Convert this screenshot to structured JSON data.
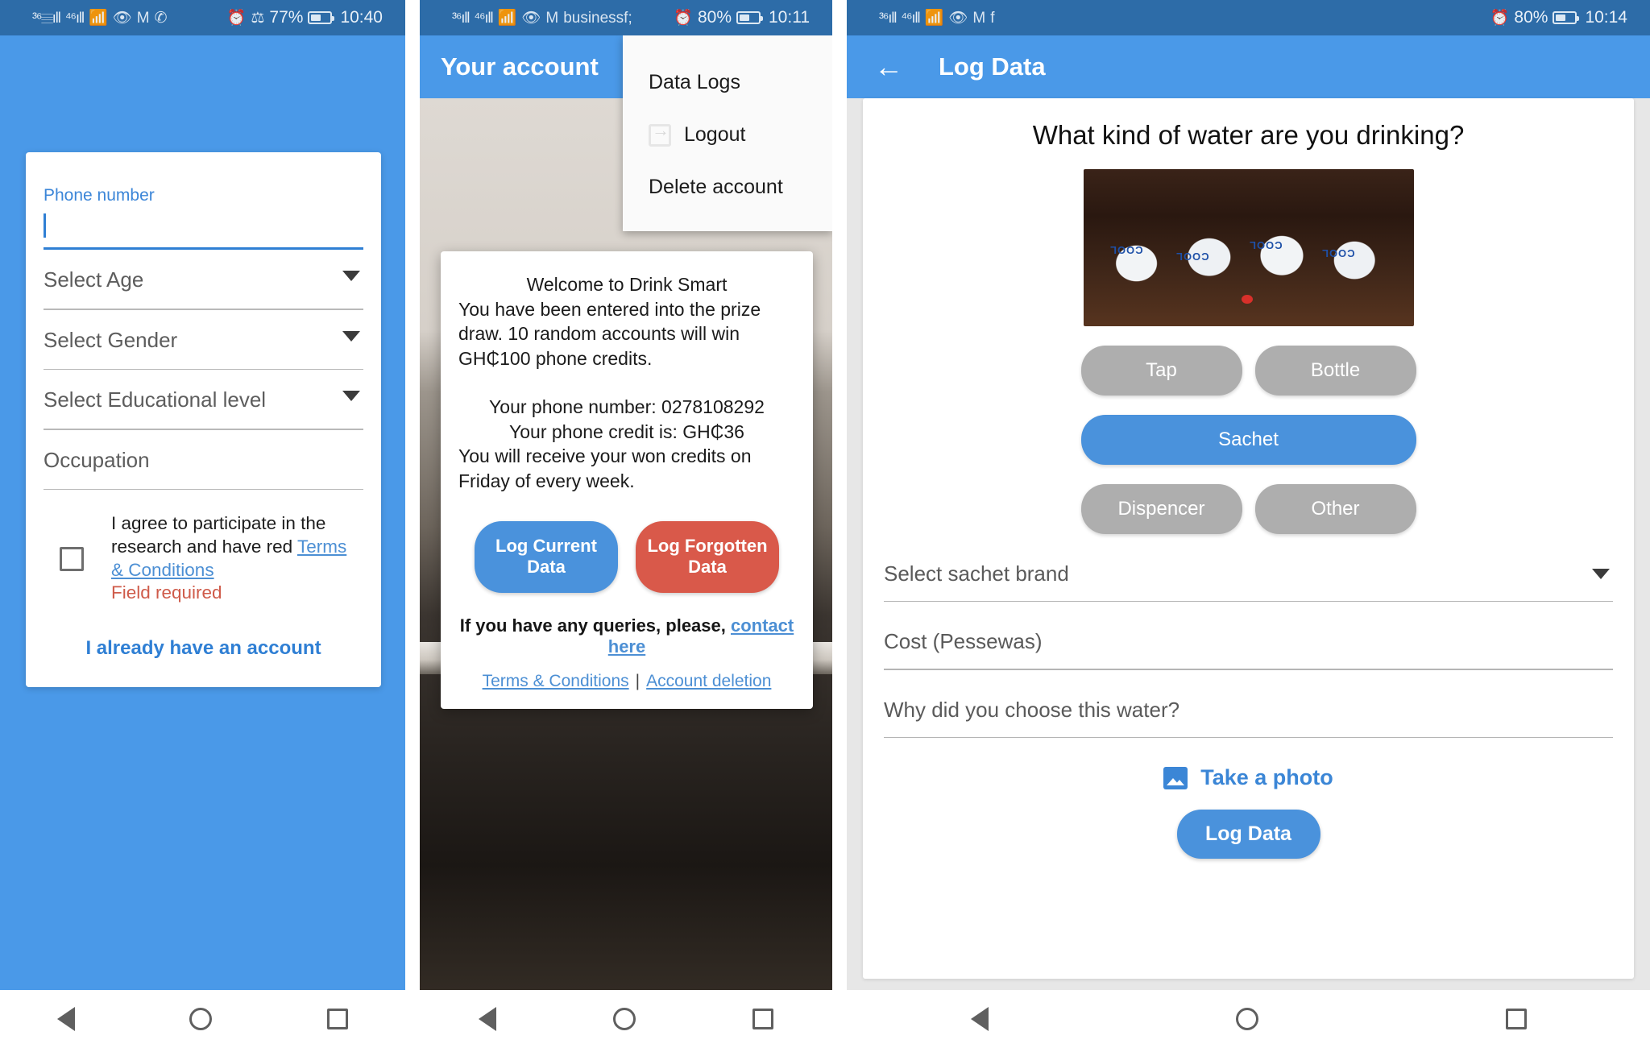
{
  "phones": [
    {
      "status_bar": {
        "icons": [
          "signal-3g-icon",
          "signal-4g-icon",
          "wifi-icon",
          "eye-icon",
          "gmail-icon",
          "whatsapp-icon"
        ],
        "alarm_icon": "alarm-icon",
        "bluetooth_icon": "bluetooth-icon",
        "battery_percent": "77%",
        "time": "10:40"
      },
      "form": {
        "phone_label": "Phone number",
        "phone_value": "",
        "age_placeholder": "Select Age",
        "gender_placeholder": "Select Gender",
        "education_placeholder": "Select Educational level",
        "occupation_placeholder": "Occupation",
        "agree_text_a": "I agree to participate in the research and have red ",
        "agree_link": "Terms & Conditions",
        "error": "Field required",
        "have_account": "I already have an account"
      }
    },
    {
      "status_bar": {
        "icons": [
          "signal-3g-icon",
          "signal-4g-icon",
          "wifi-icon",
          "eye-icon",
          "gmail-icon",
          "facebook-icon"
        ],
        "alarm_icon": "alarm-icon",
        "battery_percent": "80%",
        "time": "10:11"
      },
      "appbar_title": "Your account",
      "menu": {
        "data_logs": "Data Logs",
        "logout": "Logout",
        "delete_account": "Delete account"
      },
      "dialog": {
        "welcome": "Welcome to Drink Smart",
        "prize_text": "You have been entered into the prize draw. 10 random accounts will win GH₵100 phone credits.",
        "phone_number_line": "Your phone number: 0278108292",
        "phone_credit_line": "Your phone credit is: GH₵36",
        "friday_line": "You will receive your won credits on Friday of every week.",
        "btn_log_current": "Log Current Data",
        "btn_log_forgotten": "Log Forgotten Data",
        "queries_text": "If you have any queries, please, ",
        "contact_link": "contact here",
        "terms_link": "Terms & Conditions",
        "separator": "|",
        "deletion_link": "Account deletion"
      }
    },
    {
      "status_bar": {
        "icons": [
          "signal-3g-icon",
          "signal-4g-icon",
          "wifi-icon",
          "eye-icon",
          "gmail-icon",
          "facebook-icon"
        ],
        "alarm_icon": "alarm-icon",
        "battery_percent": "80%",
        "time": "10:14"
      },
      "appbar_title": "Log Data",
      "back_icon": "back-arrow-icon",
      "question": "What kind of water are you drinking?",
      "photo_alt": "sachet-water-photo",
      "photo_brand_text": "COOL",
      "options": [
        {
          "label": "Tap",
          "selected": false
        },
        {
          "label": "Bottle",
          "selected": false
        },
        {
          "label": "Sachet",
          "selected": true
        },
        {
          "label": "Dispencer",
          "selected": false
        },
        {
          "label": "Other",
          "selected": false
        }
      ],
      "fields": {
        "sachet_brand_placeholder": "Select sachet brand",
        "cost_placeholder": "Cost (Pessewas)",
        "why_placeholder": "Why did you choose this water?"
      },
      "take_photo": "Take a photo",
      "log_data_button": "Log Data"
    }
  ],
  "nav": {
    "back": "back-button",
    "home": "home-button",
    "recents": "recents-button"
  },
  "colors": {
    "status_bar": "#2d6ca8",
    "primary": "#4a99e8",
    "accent_blue": "#4a92dc",
    "danger_red": "#d9594a",
    "disabled_grey": "#aeaeae",
    "error_text": "#cf5b4a",
    "link": "#4c8fd4"
  }
}
